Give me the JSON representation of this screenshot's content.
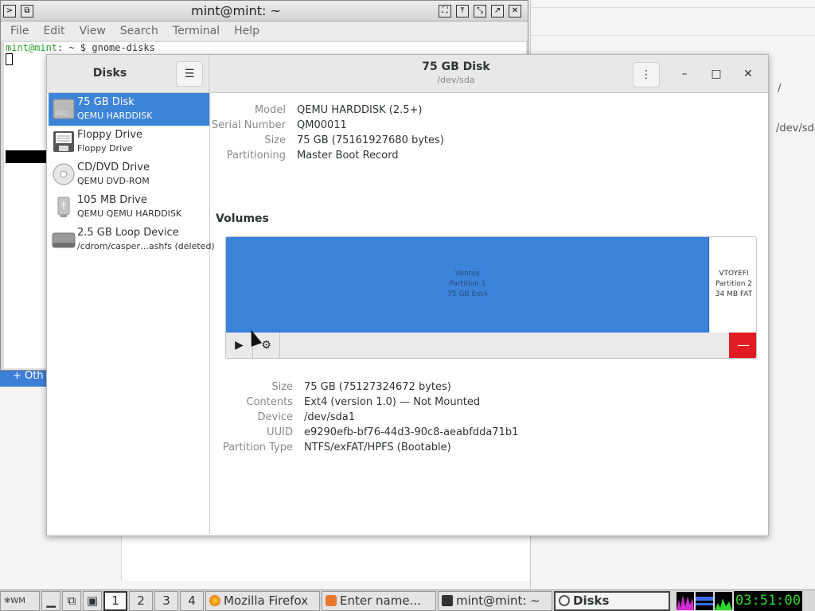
{
  "background_window": {
    "path_root": "/",
    "path_dev": "/dev/sda",
    "other_label": "+  Oth"
  },
  "terminal": {
    "title": "mint@mint: ~",
    "menu": [
      "File",
      "Edit",
      "View",
      "Search",
      "Terminal",
      "Help"
    ],
    "prompt_user": "mint@mint",
    "prompt_rest": ": ~ $ gnome-disks"
  },
  "disks_app": {
    "sidebar_title": "Disks",
    "window_title": "75 GB Disk",
    "window_subtitle": "/dev/sda",
    "drives": [
      {
        "name": "75 GB Disk",
        "desc": "QEMU HARDDISK",
        "icon": "ssd-icon",
        "selected": true
      },
      {
        "name": "Floppy Drive",
        "desc": "Floppy Drive",
        "icon": "floppy-icon",
        "selected": false
      },
      {
        "name": "CD/DVD Drive",
        "desc": "QEMU DVD-ROM",
        "icon": "cd-icon",
        "selected": false
      },
      {
        "name": "105 MB Drive",
        "desc": "QEMU QEMU HARDDISK",
        "icon": "usb-drive-icon",
        "selected": false
      },
      {
        "name": "2.5 GB Loop Device",
        "desc": "/cdrom/casper…ashfs (deleted)",
        "icon": "loop-device-icon",
        "selected": false
      }
    ],
    "disk_info": {
      "model_label": "Model",
      "model": "QEMU HARDDISK (2.5+)",
      "serial_label": "Serial Number",
      "serial": "QM00011",
      "size_label": "Size",
      "size": "75 GB (75161927680 bytes)",
      "partitioning_label": "Partitioning",
      "partitioning": "Master Boot Record"
    },
    "volumes_label": "Volumes",
    "partitions": [
      {
        "name": "Ventoy",
        "number": "Partition 1",
        "size": "75 GB Ext4"
      },
      {
        "name": "VTOYEFI",
        "number": "Partition 2",
        "size": "34 MB FAT"
      }
    ],
    "volume_info": {
      "size_label": "Size",
      "size": "75 GB (75127324672 bytes)",
      "contents_label": "Contents",
      "contents": "Ext4 (version 1.0) — Not Mounted",
      "device_label": "Device",
      "device": "/dev/sda1",
      "uuid_label": "UUID",
      "uuid": "e9290efb-bf76-44d3-90c8-aeabfdda71b1",
      "ptype_label": "Partition Type",
      "ptype": "NTFS/exFAT/HPFS (Bootable)"
    }
  },
  "taskbar": {
    "workspaces": [
      "1",
      "2",
      "3",
      "4"
    ],
    "active_workspace": "1",
    "tasks": [
      {
        "label": "Mozilla Firefox",
        "icon": "firefox-icon"
      },
      {
        "label": "Enter name...",
        "icon": "installer-icon"
      },
      {
        "label": "mint@mint: ~",
        "icon": "terminal-icon"
      },
      {
        "label": "Disks",
        "icon": "disks-icon"
      }
    ],
    "clock": "03:51:00"
  }
}
